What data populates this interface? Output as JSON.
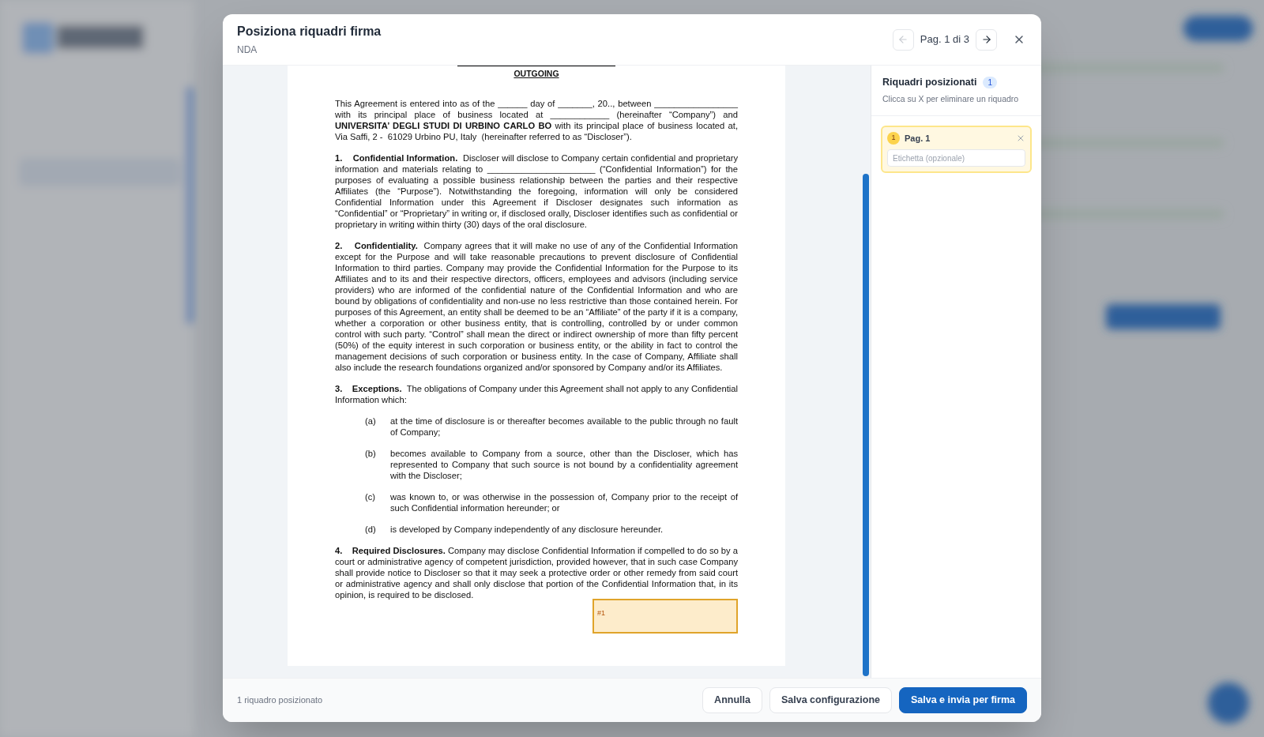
{
  "dialog": {
    "title": "Posiziona riquadri firma",
    "subtitle": "NDA",
    "pager": {
      "label": "Pag. 1 di 3",
      "prev_disabled": true,
      "next_disabled": false
    }
  },
  "document": {
    "heading": "OUTGOING",
    "blocks": [
      {
        "kind": "paragraph",
        "text": "This Agreement is entered into as of the ______ day of _______, 20.., between _________________ with its principal place of business located at ____________ (hereinafter “Company”) and **UNIVERSITA’ DEGLI STUDI DI URBINO CARLO BO** with its principal place of business located at, Via Saffi, 2 -  61029 Urbino PU, Italy  (hereinafter referred to as “Discloser”)."
      },
      {
        "kind": "paragraph",
        "text": "**1.    Confidential Information.**  Discloser will disclose to Company certain confidential and proprietary information and materials relating to ______________________ (“Confidential Information”) for the purposes of evaluating a possible business relationship between the parties and their respective Affiliates (the “Purpose”). Notwithstanding the foregoing, information will only be considered Confidential Information under this Agreement if Discloser designates such information as “Confidential” or “Proprietary” in writing or, if disclosed orally, Discloser identifies such as confidential or proprietary in writing within thirty (30) days of the oral disclosure."
      },
      {
        "kind": "paragraph",
        "text": "**2.    Confidentiality.**  Company agrees that it will make no use of any of the Confidential Information except for the Purpose and will take reasonable precautions to prevent disclosure of Confidential Information to third parties. Company may provide the Confidential Information for the Purpose to its Affiliates and to its and their respective directors, officers, employees and advisors (including service providers) who are informed of the confidential nature of the Confidential Information and who are bound by obligations of confidentiality and non-use no less restrictive than those contained herein. For purposes of this Agreement, an entity shall be deemed to be an “Affiliate” of the party if it is a company, whether a corporation or other business entity, that is controlling, controlled by or under common control with such party. “Control” shall mean the direct or indirect ownership of more than fifty percent (50%) of the equity interest in such corporation or business entity, or the ability in fact to control the management decisions of such corporation or business entity. In the case of Company, Affiliate shall also include the research foundations organized and/or sponsored by Company and/or its Affiliates."
      },
      {
        "kind": "paragraph",
        "text": "**3.    Exceptions.**  The obligations of Company under this Agreement shall not apply to any Confidential Information which:"
      },
      {
        "kind": "item",
        "label": "(a)",
        "text": "at the time of disclosure is or thereafter becomes available to the public through no fault of Company;"
      },
      {
        "kind": "item",
        "label": "(b)",
        "text": "becomes available to Company from a source, other than the Discloser, which has represented to Company that such source is not bound by a confidentiality agreement with the Discloser;"
      },
      {
        "kind": "item",
        "label": "(c)",
        "text": "was known to, or was otherwise in the possession of, Company prior to the receipt of such Confidential information hereunder; or"
      },
      {
        "kind": "item",
        "label": "(d)",
        "text": "is developed by Company independently of any disclosure hereunder."
      },
      {
        "kind": "paragraph",
        "text": "**4.    Required Disclosures.** Company may disclose Confidential Information if compelled to do so by a court or administrative agency of competent jurisdiction, provided however, that in such case Company shall provide notice to Discloser so that it may seek a protective order or other remedy from said court or administrative agency and shall only disclose that portion of the Confidential Information that, in its opinion, is required to be disclosed."
      }
    ],
    "signature_boxes": [
      {
        "label": "#1"
      }
    ]
  },
  "panel": {
    "title": "Riquadri posizionati",
    "count": "1",
    "hint": "Clicca su X per eliminare un riquadro",
    "boxes": [
      {
        "number": "1",
        "page": "Pag. 1",
        "placeholder": "Etichetta (opzionale)",
        "selected": true
      }
    ]
  },
  "footer": {
    "status": "1 riquadro posizionato",
    "buttons": [
      {
        "label": "Annulla",
        "kind": "secondary"
      },
      {
        "label": "Salva configurazione",
        "kind": "secondary"
      },
      {
        "label": "Salva e invia per firma",
        "kind": "primary"
      }
    ]
  }
}
